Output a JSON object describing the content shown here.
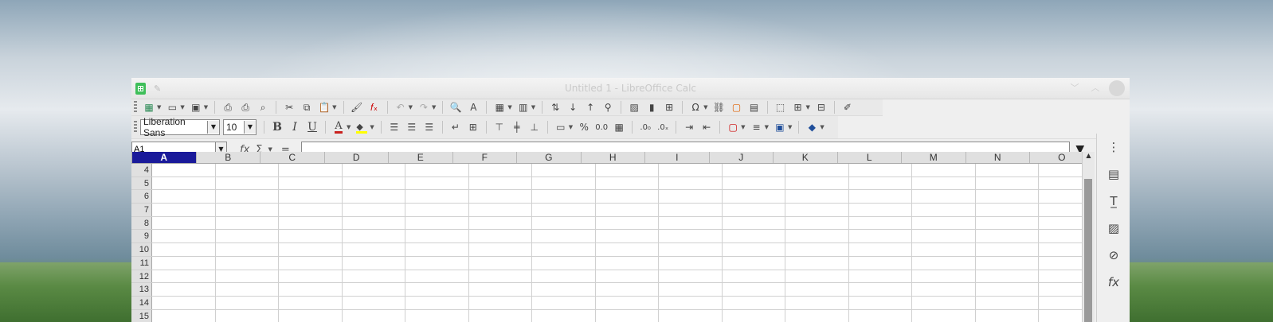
{
  "window": {
    "title": "Untitled 1 - LibreOffice Calc"
  },
  "toolbar_standard": {
    "items": [
      "new-spreadsheet",
      "templates",
      "open",
      "save",
      "export-pdf",
      "print",
      "print-preview",
      "cut",
      "copy",
      "paste",
      "clone-formatting",
      "clear-formatting",
      "undo",
      "redo",
      "find-replace",
      "spelling",
      "row",
      "column",
      "sort",
      "sort-ascending",
      "sort-descending",
      "autofilter",
      "image",
      "chart",
      "pivot-table",
      "special-character",
      "hyperlink",
      "comment",
      "headers-footers",
      "define-print-area",
      "freeze-rows-columns",
      "split-window",
      "show-draw-functions"
    ]
  },
  "toolbar_formatting": {
    "font_name": "Liberation Sans",
    "font_size": "10",
    "bold": "B",
    "italic": "I",
    "underline": "U",
    "percent": "%",
    "number_format": "0.0"
  },
  "formula_bar": {
    "name_box": "A1",
    "fx": "fx",
    "sum": "Σ",
    "equals": "=",
    "content": ""
  },
  "sheet": {
    "columns": [
      "A",
      "B",
      "C",
      "D",
      "E",
      "F",
      "G",
      "H",
      "I",
      "J",
      "K",
      "L",
      "M",
      "N",
      "O"
    ],
    "active_column": "A",
    "rows": [
      "4",
      "5",
      "6",
      "7",
      "8",
      "9",
      "10",
      "11",
      "12",
      "13",
      "14",
      "15"
    ]
  },
  "sidebar": {
    "items": [
      "menu",
      "properties",
      "styles",
      "gallery",
      "navigator",
      "functions"
    ]
  },
  "colors": {
    "accent": "#1a1a9a",
    "font_color": "#c9211e",
    "highlight": "#ffff00"
  }
}
